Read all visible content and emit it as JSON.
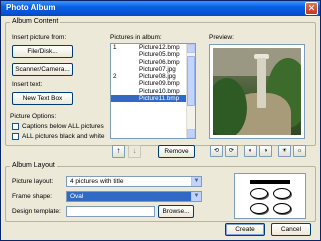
{
  "window": {
    "title": "Photo Album",
    "close_glyph": "✕"
  },
  "album_content": {
    "group_title": "Album Content",
    "insert_picture_label": "Insert picture from:",
    "file_disk_button": "File/Disk...",
    "scanner_button": "Scanner/Camera...",
    "insert_text_label": "Insert text:",
    "new_text_box_button": "New Text Box",
    "picture_options_label": "Picture Options:",
    "captions_checkbox": "Captions below ALL pictures",
    "bw_checkbox": "ALL pictures black and white"
  },
  "pictures": {
    "label": "Pictures in album:",
    "items": [
      {
        "num": "1",
        "name": "Picture12.bmp",
        "selected": false
      },
      {
        "num": "",
        "name": "Picture05.bmp",
        "selected": false
      },
      {
        "num": "",
        "name": "Picture06.bmp",
        "selected": false
      },
      {
        "num": "",
        "name": "Picture07.jpg",
        "selected": false
      },
      {
        "num": "2",
        "name": "Picture08.jpg",
        "selected": false
      },
      {
        "num": "",
        "name": "Picture09.bmp",
        "selected": false
      },
      {
        "num": "",
        "name": "Picture10.bmp",
        "selected": false
      },
      {
        "num": "",
        "name": "Picture11.bmp",
        "selected": true
      }
    ],
    "move_up_glyph": "↑",
    "move_down_glyph": "↓",
    "remove_button": "Remove"
  },
  "preview": {
    "label": "Preview:",
    "tools": [
      {
        "icon": "rotate-left-icon",
        "glyph": "⟲"
      },
      {
        "icon": "rotate-right-icon",
        "glyph": "⟳"
      },
      {
        "icon": "contrast-more-icon",
        "glyph": "◐"
      },
      {
        "icon": "contrast-less-icon",
        "glyph": "◑"
      },
      {
        "icon": "brightness-more-icon",
        "glyph": "☀"
      },
      {
        "icon": "brightness-less-icon",
        "glyph": "☼"
      }
    ]
  },
  "album_layout": {
    "group_title": "Album Layout",
    "picture_layout_label": "Picture layout:",
    "picture_layout_value": "4 pictures with title",
    "frame_shape_label": "Frame shape:",
    "frame_shape_value": "Oval",
    "design_template_label": "Design template:",
    "design_template_value": "",
    "browse_button": "Browse..."
  },
  "footer": {
    "create_button": "Create",
    "cancel_button": "Cancel"
  },
  "colors": {
    "title_blue": "#0453d9",
    "selection": "#316ac5",
    "dialog_bg": "#ece9d8"
  }
}
